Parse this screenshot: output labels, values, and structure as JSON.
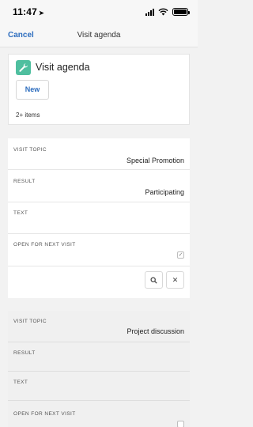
{
  "status_bar": {
    "time": "11:47",
    "location_arrow": "➤"
  },
  "nav": {
    "cancel_label": "Cancel",
    "title": "Visit agenda"
  },
  "card": {
    "icon": "wrench-icon",
    "title": "Visit agenda",
    "new_label": "New",
    "items_count": "2+ items"
  },
  "records": [
    {
      "visit_topic_label": "VISIT TOPIC",
      "visit_topic": "Special Promotion",
      "result_label": "RESULT",
      "result": "Participating",
      "text_label": "TEXT",
      "open_label": "OPEN FOR NEXT VISIT",
      "open_checked": true,
      "check_mark": "✓",
      "clear_mark": "✕"
    },
    {
      "visit_topic_label": "VISIT TOPIC",
      "visit_topic": "Project discussion",
      "result_label": "RESULT",
      "text_label": "TEXT",
      "open_label": "OPEN FOR NEXT VISIT",
      "open_checked": false
    }
  ],
  "colors": {
    "accent": "#2d6dbe",
    "icon_bg": "#4fbf9f"
  }
}
